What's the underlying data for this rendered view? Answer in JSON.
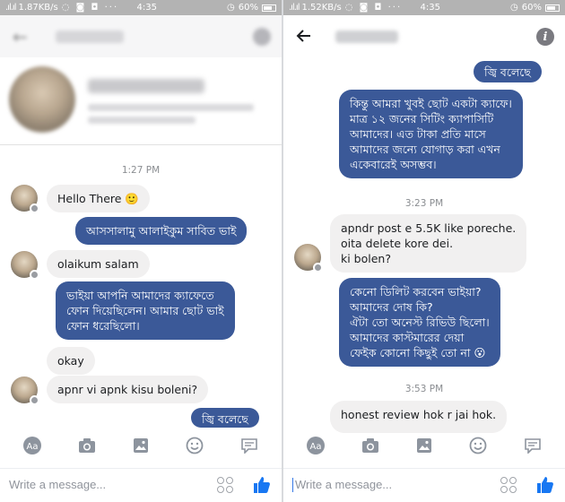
{
  "left": {
    "status": {
      "net_speed": "1.87KB/s",
      "time": "4:35",
      "battery": "60%"
    },
    "time_label": "1:27 PM",
    "messages": {
      "m1": "Hello There 🙂",
      "m2": "আসসালামু আলাইকুম সাবিত ভাই",
      "m3": "olaikum salam",
      "m4_l1": "ভাইয়া আপনি আমাদের ক্যাফেতে",
      "m4_l2": "ফোন দিয়েছিলেন। আমার ছোট ভাই",
      "m4_l3": "ফোন ধরেছিলো।",
      "m5": "okay",
      "m6": "apnr vi apnk kisu boleni?",
      "m7": "জ্বি বলেছে"
    },
    "composer_placeholder": "Write a message..."
  },
  "right": {
    "status": {
      "net_speed": "1.52KB/s",
      "time": "4:35",
      "battery": "60%"
    },
    "messages": {
      "m1": "জ্বি বলেছে",
      "m2_l1": "কিন্তু আমরা খুবই ছোট একটা ক্যাফে।",
      "m2_l2": "মাত্র ১২ জনের সিটিং ক্যাপাসিটি",
      "m2_l3": "আমাদের। এত টাকা প্রতি মাসে",
      "m2_l4": "আমাদের জন্যে যোগাড় করা এখন",
      "m2_l5": "একেবারেই অসম্ভব।",
      "time1": "3:23 PM",
      "m3_l1": "apndr post e 5.5K like poreche.",
      "m3_l2": "oita delete kore dei.",
      "m3_l3": "ki bolen?",
      "m4_l1": "কেনো ডিলিট করবেন ভাইয়া?",
      "m4_l2": "আমাদের দোষ কি?",
      "m4_l3": "ঐটা তো অনেস্ট রিভিউ ছিলো।",
      "m4_l4": "আমাদের কাস্টমারের দেয়া",
      "m4_l5": "ফেইক কোনো কিছুই তো না 😮",
      "time2": "3:53 PM",
      "m5_l1": "honest review hok r jai hok."
    },
    "composer_placeholder": "Write a message..."
  },
  "icons": {
    "back": "arrow-left-icon",
    "info": "info-icon",
    "text_format": "aa-icon",
    "camera": "camera-icon",
    "gallery": "image-icon",
    "emoji": "smiley-icon",
    "sticker": "sticker-icon",
    "like": "thumbs-up-icon"
  },
  "colors": {
    "outgoing_bubble": "#3b5998",
    "incoming_bubble": "#f1f0f0",
    "like_blue": "#1877f2"
  }
}
